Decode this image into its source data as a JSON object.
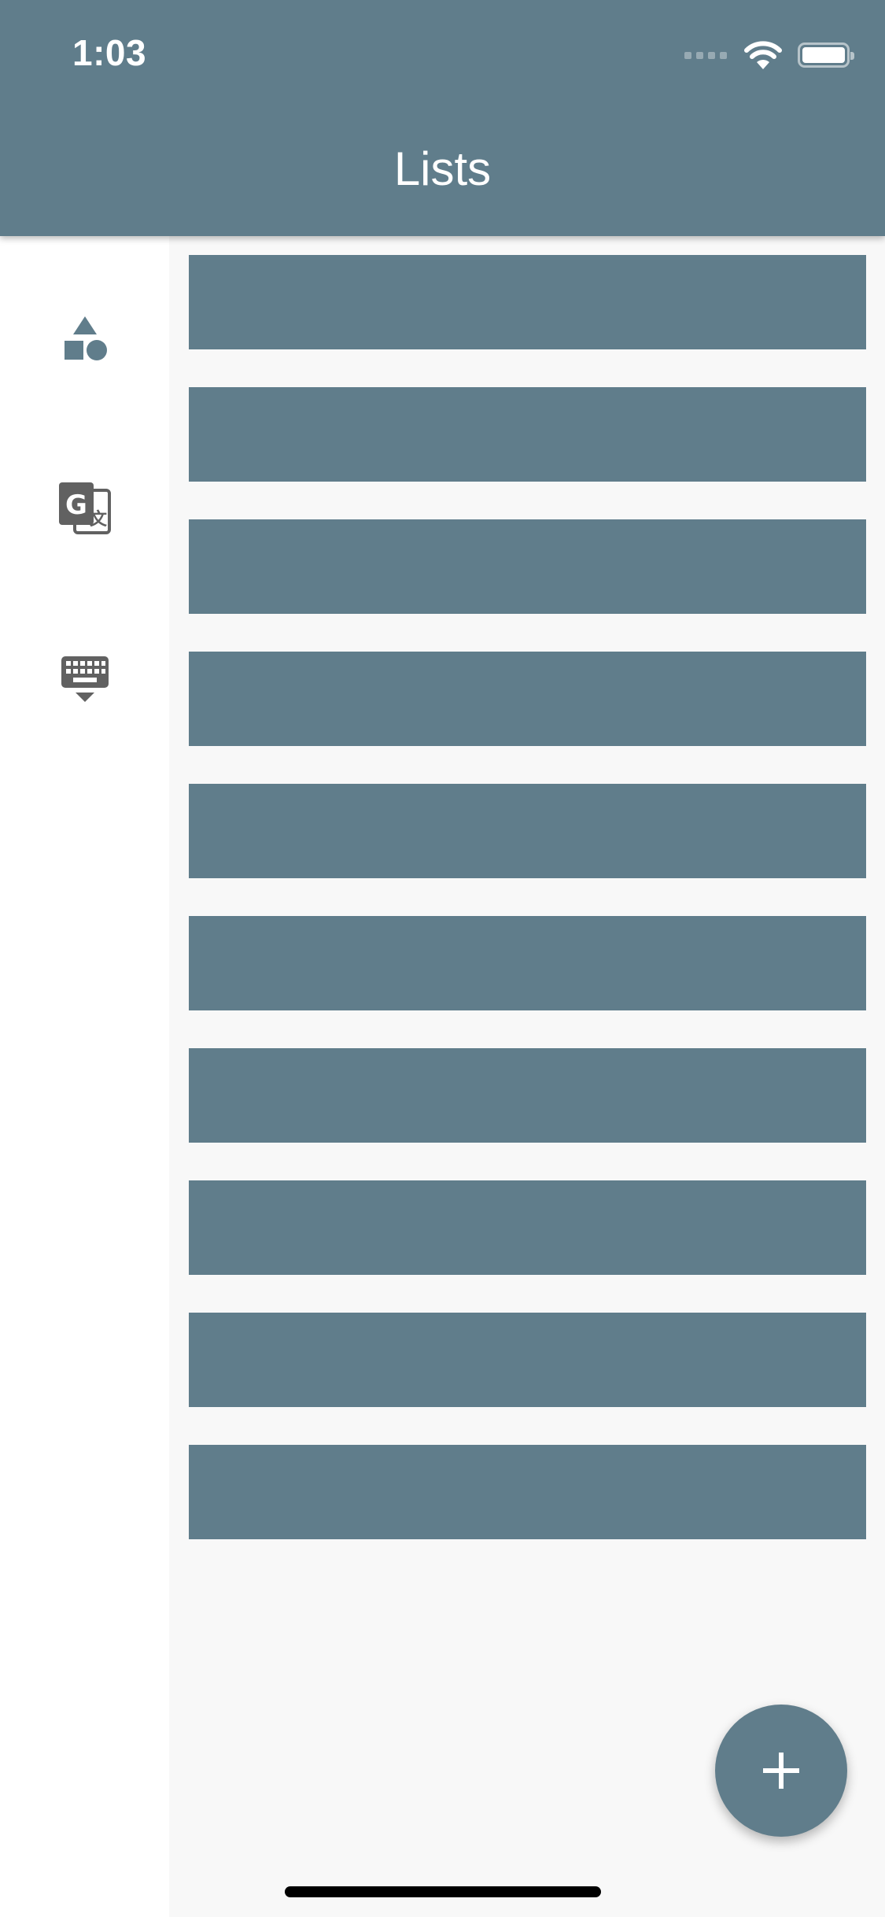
{
  "status_bar": {
    "time": "1:03",
    "icons": [
      "cellular-signal-icon",
      "wifi-icon",
      "battery-icon"
    ]
  },
  "app_bar": {
    "title": "Lists",
    "color": "#607d8b"
  },
  "nav_rail": {
    "items": [
      {
        "icon": "shapes-icon",
        "color": "#607d8b"
      },
      {
        "icon": "translate-icon",
        "color": "#616161"
      },
      {
        "icon": "keyboard-hide-icon",
        "color": "#616161"
      }
    ]
  },
  "list": {
    "item_count": 10,
    "item_color": "#607d8b"
  },
  "fab": {
    "icon": "plus-icon",
    "color": "#607d8b"
  }
}
